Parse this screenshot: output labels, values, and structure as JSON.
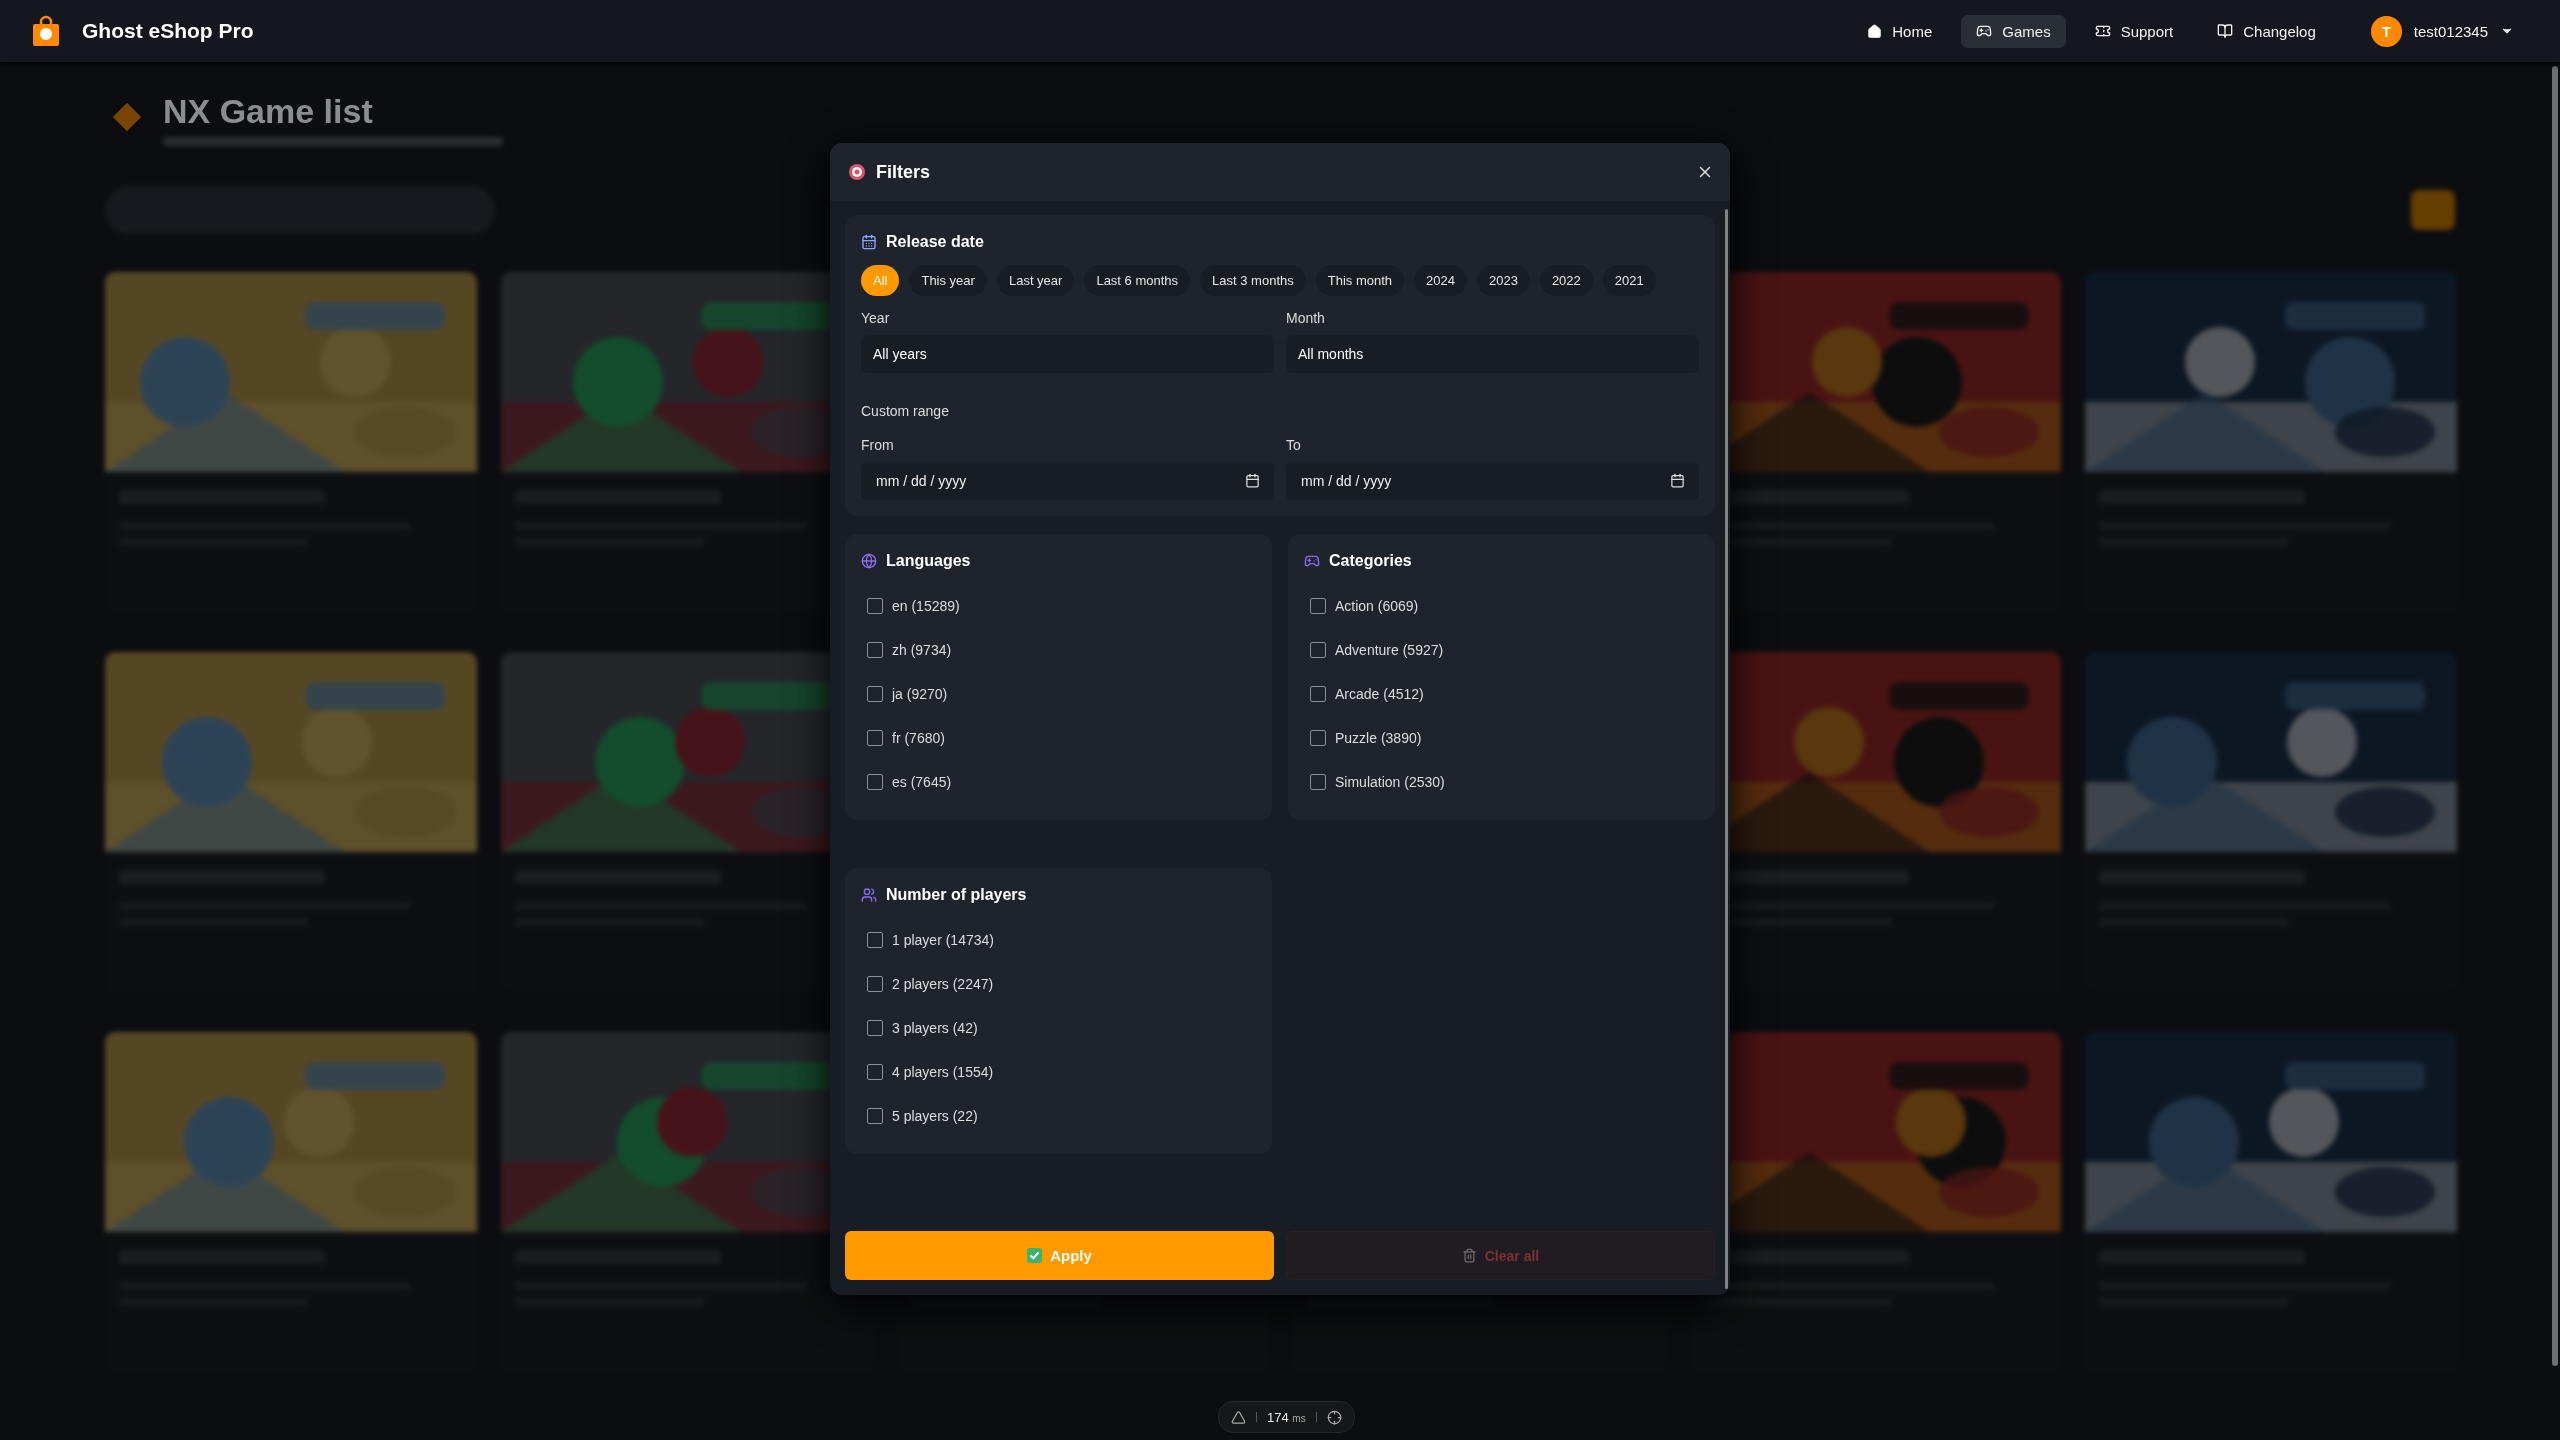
{
  "navbar": {
    "brand": "Ghost eShop Pro",
    "items": [
      {
        "label": "Home",
        "kind": "home",
        "selected": false
      },
      {
        "label": "Games",
        "kind": "gamepad",
        "selected": true
      },
      {
        "label": "Support",
        "kind": "ticket",
        "selected": false
      },
      {
        "label": "Changelog",
        "kind": "book",
        "selected": false
      }
    ],
    "user": {
      "initial": "T",
      "name": "test012345"
    }
  },
  "background": {
    "heading": "NX Game list"
  },
  "filters": {
    "title": "Filters",
    "release_date": {
      "title": "Release date",
      "chips": [
        {
          "label": "All",
          "selected": true
        },
        {
          "label": "This year",
          "selected": false
        },
        {
          "label": "Last year",
          "selected": false
        },
        {
          "label": "Last 6 months",
          "selected": false
        },
        {
          "label": "Last 3 months",
          "selected": false
        },
        {
          "label": "This month",
          "selected": false
        },
        {
          "label": "2024",
          "selected": false
        },
        {
          "label": "2023",
          "selected": false
        },
        {
          "label": "2022",
          "selected": false
        },
        {
          "label": "2021",
          "selected": false
        }
      ],
      "year": {
        "label": "Year",
        "value": "All years"
      },
      "month": {
        "label": "Month",
        "value": "All months"
      },
      "custom_range": "Custom range",
      "from": {
        "label": "From",
        "placeholder": "mm / dd / yyyy"
      },
      "to": {
        "label": "To",
        "placeholder": "mm / dd / yyyy"
      }
    },
    "languages": {
      "title": "Languages",
      "items": [
        {
          "label": "en (15289)",
          "checked": false
        },
        {
          "label": "zh (9734)",
          "checked": false
        },
        {
          "label": "ja (9270)",
          "checked": false
        },
        {
          "label": "fr (7680)",
          "checked": false
        },
        {
          "label": "es (7645)",
          "checked": false
        }
      ]
    },
    "categories": {
      "title": "Categories",
      "items": [
        {
          "label": "Action (6069)",
          "checked": false
        },
        {
          "label": "Adventure (5927)",
          "checked": false
        },
        {
          "label": "Arcade (4512)",
          "checked": false
        },
        {
          "label": "Puzzle (3890)",
          "checked": false
        },
        {
          "label": "Simulation (2530)",
          "checked": false
        }
      ]
    },
    "players": {
      "title": "Number of players",
      "items": [
        {
          "label": "1 player (14734)",
          "checked": false
        },
        {
          "label": "2 players (2247)",
          "checked": false
        },
        {
          "label": "3 players (42)",
          "checked": false
        },
        {
          "label": "4 players (1554)",
          "checked": false
        },
        {
          "label": "5 players (22)",
          "checked": false
        }
      ]
    },
    "apply": {
      "label": "Apply"
    },
    "clear": {
      "label": "Clear all",
      "disabled": true
    }
  },
  "timing": {
    "value": "174",
    "unit": "ms"
  }
}
